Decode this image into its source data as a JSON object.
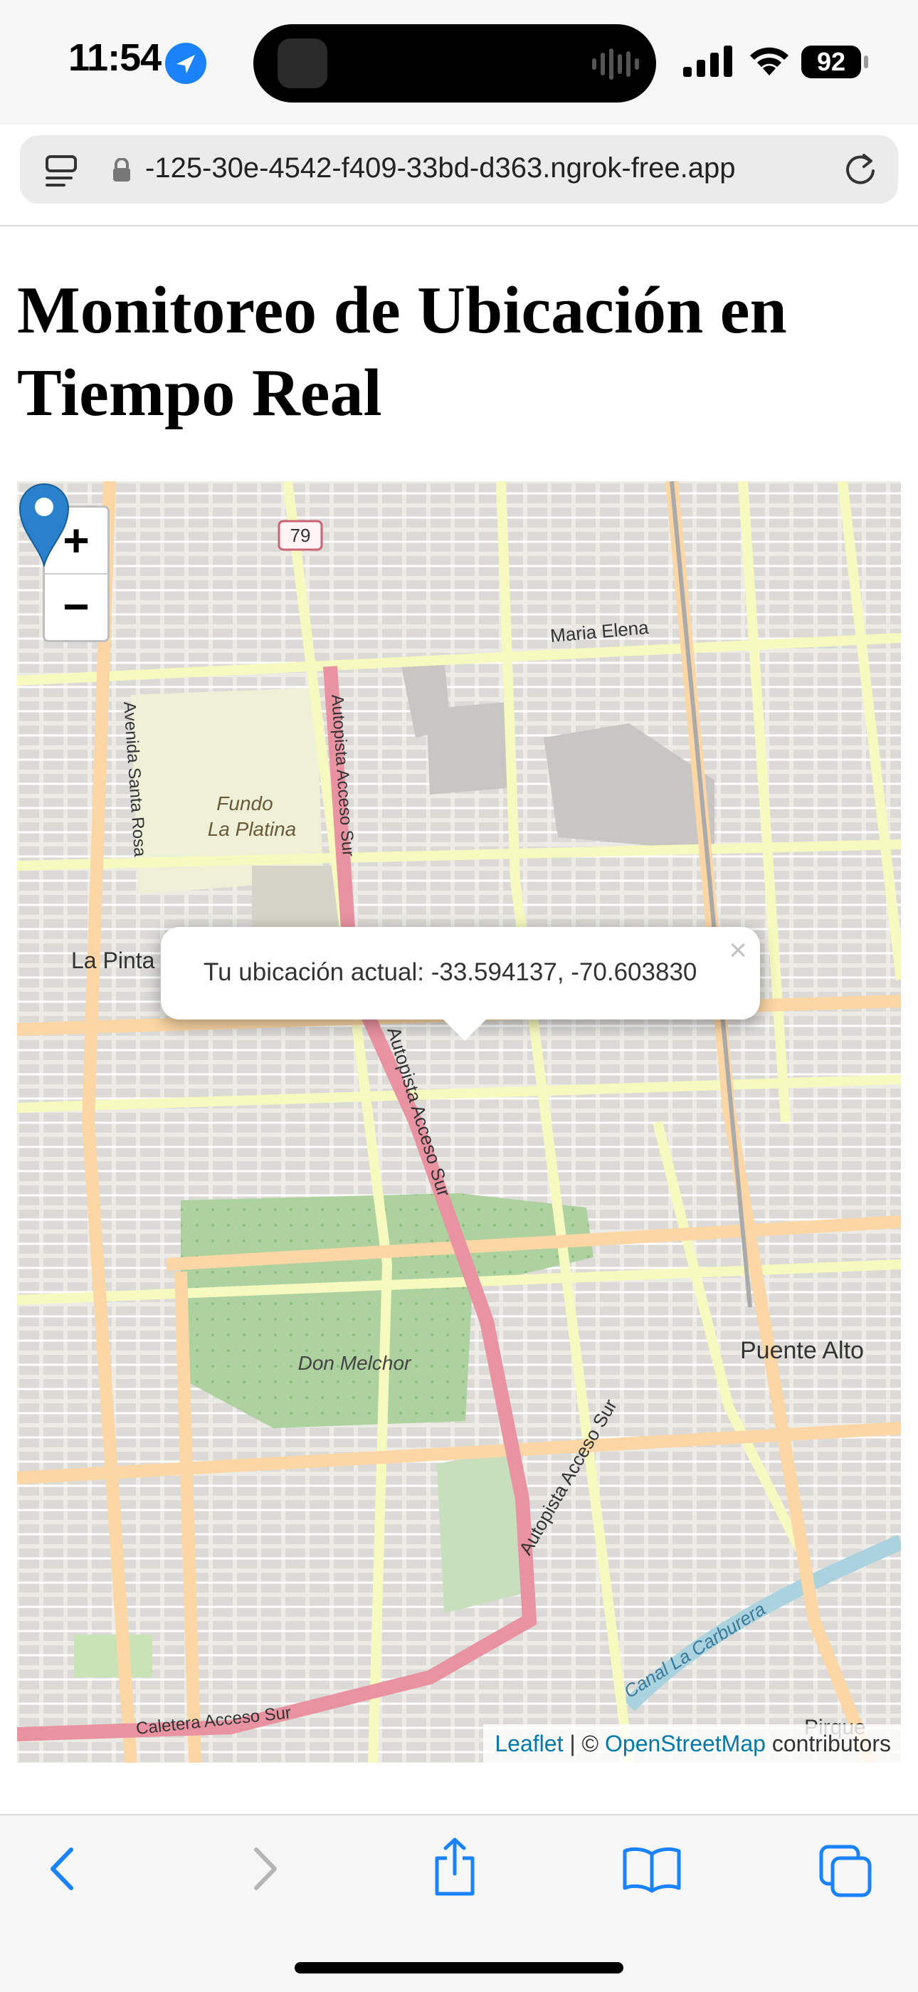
{
  "status_bar": {
    "time": "11:54",
    "battery": "92",
    "icons": [
      "location-arrow-icon",
      "signal-icon",
      "wifi-icon",
      "battery-icon"
    ]
  },
  "browser": {
    "url": "-125-30e-4542-f409-33bd-d363.ngrok-free.app",
    "icons": [
      "tabs-icon",
      "lock-icon",
      "reload-icon"
    ]
  },
  "page": {
    "title": "Monitoreo de Ubicación en Tiempo Real"
  },
  "map": {
    "zoom_in_label": "+",
    "zoom_out_label": "−",
    "popup_text": "Tu ubicación actual: -33.594137, -70.603830",
    "popup_close": "×",
    "labels": {
      "route_shield": "79",
      "maria_elena": "Maria Elena",
      "avenida_santa_rosa": "Avenida Santa Rosa",
      "fundo_line1": "Fundo",
      "fundo_line2": "La Platina",
      "autopista_1": "Autopista Acceso Sur",
      "autopista_2": "Autopista Acceso Sur",
      "autopista_3": "Autopista Acceso Sur",
      "la_pintana": "La Pinta",
      "don_melchor": "Don Melchor",
      "puente_alto": "Puente Alto",
      "canal": "Canal La Carburera",
      "caletera": "Caletera Acceso Sur",
      "pirque": "Pirque"
    },
    "attribution": {
      "leaflet": "Leaflet",
      "separator": " | © ",
      "osm": "OpenStreetMap",
      "suffix": " contributors"
    },
    "colors": {
      "land": "#f2efe9",
      "residential": "#e0dfdf",
      "park": "#add19e",
      "trunk": "#e892a2",
      "primary": "#fcd6a4",
      "secondary": "#f7fabf",
      "water": "#aad3df",
      "marker": "#2a81cb"
    }
  },
  "toolbar": {
    "icons": [
      "back-icon",
      "forward-icon",
      "share-icon",
      "bookmarks-icon",
      "tabs-overview-icon"
    ]
  }
}
